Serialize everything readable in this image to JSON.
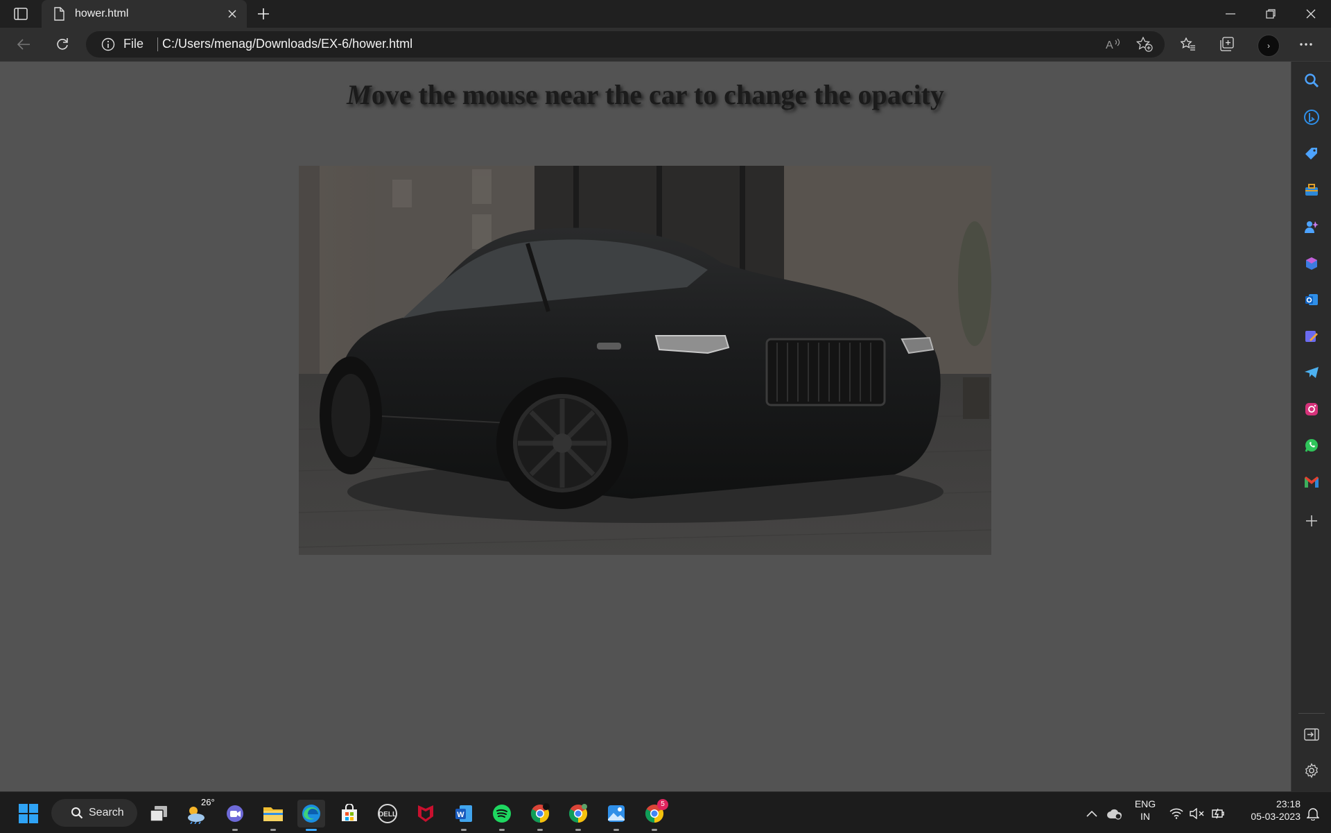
{
  "browser": {
    "tab": {
      "title": "hower.html"
    },
    "address": {
      "scheme": "File",
      "url": "C:/Users/menag/Downloads/EX-6/hower.html"
    }
  },
  "page": {
    "heading_first": "M",
    "heading_rest": "ove the mouse near the car to change the opacity",
    "image_subject": "dark luxury coupe (car photo, reduced opacity)"
  },
  "sidebar": {
    "icons": [
      "search-icon",
      "bing-icon",
      "shopping-tag-icon",
      "tools-icon",
      "games-icon",
      "office-icon",
      "outlook-icon",
      "designer-icon",
      "telegram-icon",
      "instagram-icon",
      "whatsapp-icon",
      "gmail-icon",
      "add-icon"
    ]
  },
  "taskbar": {
    "search_label": "Search",
    "weather_temp": "26°",
    "chrome_badge": "5",
    "lang_line1": "ENG",
    "lang_line2": "IN",
    "time": "23:18",
    "date": "05-03-2023"
  },
  "colors": {
    "page_bg": "#535353",
    "accent": "#3da8ff",
    "chrome_dark": "#202020"
  }
}
